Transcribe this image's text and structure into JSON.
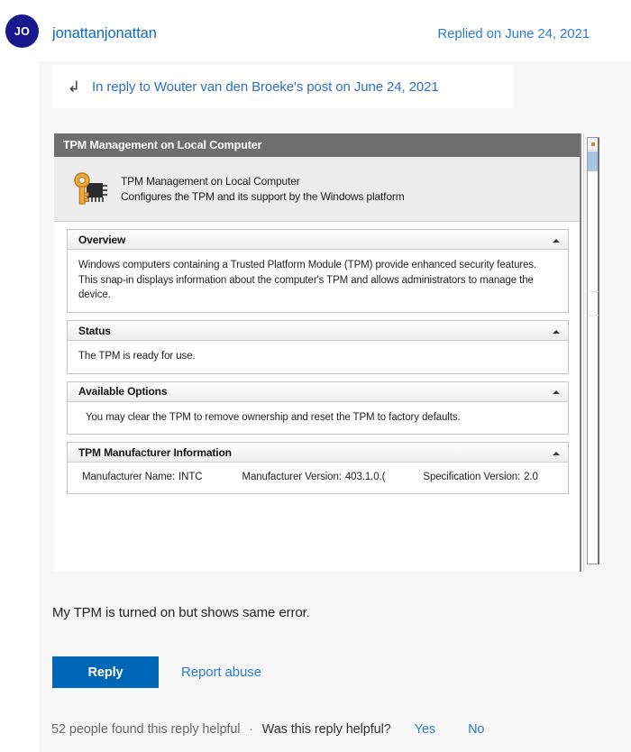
{
  "post": {
    "avatar_initials": "JO",
    "username": "jonattanjonattan",
    "replied_on": "Replied on June 24, 2021",
    "reply_reference": "In reply to Wouter van den Broeke's post on June 24, 2021",
    "body_text": "My TPM is turned on but shows same error."
  },
  "actions": {
    "reply_label": "Reply",
    "report_abuse_label": "Report abuse"
  },
  "feedback": {
    "helpful_count": "52 people found this reply helpful",
    "separator": "·",
    "question": "Was this reply helpful?",
    "yes_label": "Yes",
    "no_label": "No"
  },
  "screenshot": {
    "window_title": "TPM Management on Local Computer",
    "banner": {
      "heading": "TPM Management on Local Computer",
      "subheading": "Configures the TPM and its support by the Windows platform"
    },
    "sections": [
      {
        "title": "Overview",
        "body": "Windows computers containing a Trusted Platform Module (TPM) provide enhanced security features. This snap-in displays information about the computer's TPM and allows administrators to manage the device."
      },
      {
        "title": "Status",
        "body": "The TPM is ready for use."
      },
      {
        "title": "Available Options",
        "body": "You may clear the TPM to remove ownership and reset the TPM to factory defaults."
      }
    ],
    "manufacturer_section": {
      "title": "TPM Manufacturer Information",
      "fields": [
        {
          "label": "Manufacturer Name:",
          "value": "INTC"
        },
        {
          "label": "Manufacturer Version:",
          "value": "403.1.0.("
        },
        {
          "label": "Specification Version:",
          "value": "2.0"
        }
      ]
    }
  },
  "colors": {
    "link_blue": "#2d7dd2",
    "button_blue": "#0067b8",
    "avatar_navy": "#17198c",
    "page_gray": "#f7f7f7",
    "titlebar_gray": "#6e6e6e"
  }
}
